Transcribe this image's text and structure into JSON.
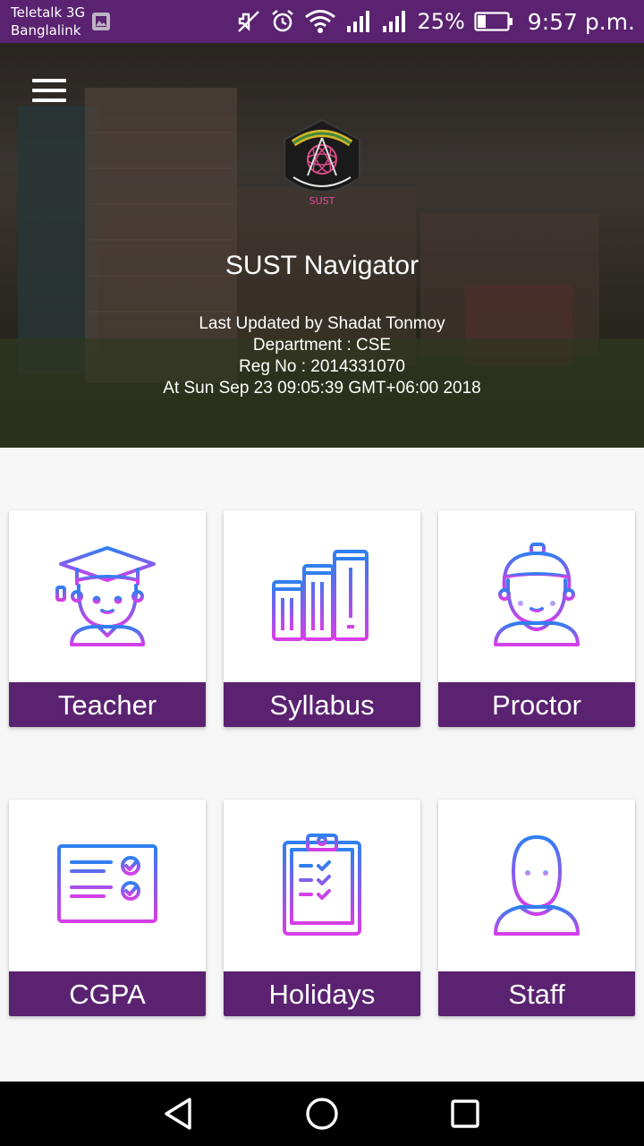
{
  "status_bar": {
    "carrier_1": "Teletalk 3G",
    "carrier_2": "Banglalink",
    "battery": "25%",
    "time": "9:57 p.m.",
    "icons": [
      "gallery-icon",
      "mute-icon",
      "alarm-icon",
      "wifi-icon",
      "signal-icon",
      "signal-icon",
      "battery-icon"
    ]
  },
  "header": {
    "app_title": "SUST Navigator",
    "updated_by": "Last Updated by Shadat Tonmoy",
    "department": "Department : CSE",
    "reg_no": "Reg No : 2014331070",
    "timestamp": "At Sun Sep 23 09:05:39 GMT+06:00 2018",
    "logo_text": "SUST"
  },
  "menu": {
    "items": [
      {
        "label": "Teacher",
        "icon": "teacher-icon"
      },
      {
        "label": "Syllabus",
        "icon": "books-icon"
      },
      {
        "label": "Proctor",
        "icon": "proctor-icon"
      },
      {
        "label": "CGPA",
        "icon": "certificate-icon"
      },
      {
        "label": "Holidays",
        "icon": "clipboard-icon"
      },
      {
        "label": "Staff",
        "icon": "staff-icon"
      }
    ]
  },
  "colors": {
    "primary": "#5a2270",
    "icon_gradient_top": "#2f7ff0",
    "icon_gradient_bottom": "#d63ee8"
  }
}
